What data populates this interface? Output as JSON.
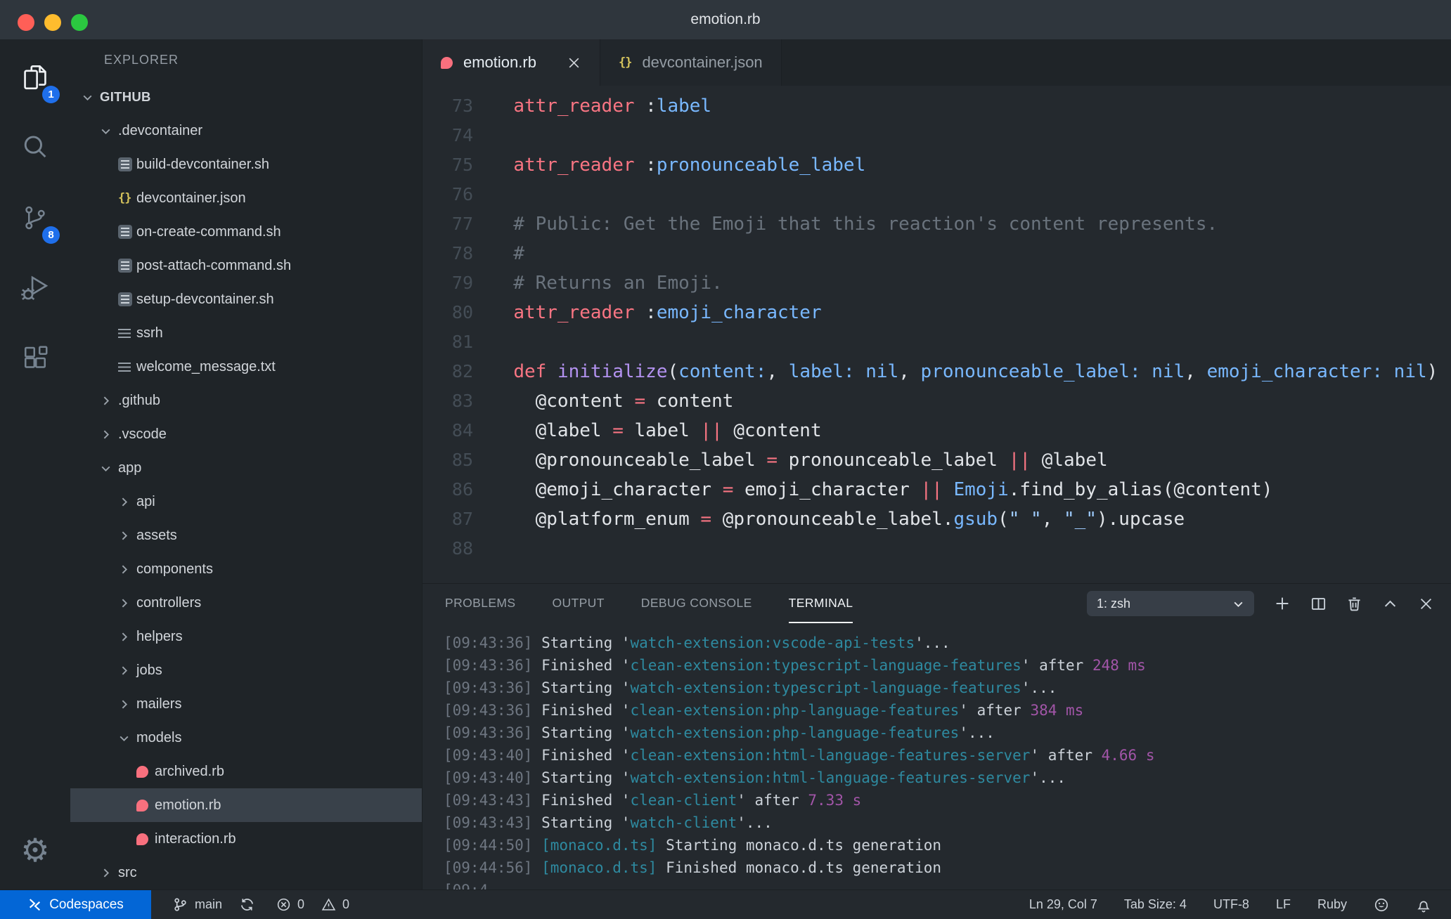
{
  "window": {
    "title": "emotion.rb"
  },
  "colors": {
    "accent": "#0366d6",
    "badge": "#1f6feb",
    "ruby": "#f8707e",
    "json_icon": "#d5c35c",
    "keyword": "#f97583",
    "symbol": "#79b8ff",
    "func": "#b392f0",
    "string": "#9ecbff",
    "comment": "#6a737d",
    "code_text": "#e1e4e8",
    "term_cyan": "#2e8aa0",
    "term_magenta": "#a255a8",
    "term_text": "#ccd2d9",
    "term_timestamp": "#6e7681"
  },
  "activity_bar": {
    "items": [
      {
        "name": "explorer",
        "active": true,
        "badge": "1"
      },
      {
        "name": "search"
      },
      {
        "name": "source-control",
        "badge": "8"
      },
      {
        "name": "run-debug"
      },
      {
        "name": "extensions"
      }
    ],
    "bottom_items": [
      {
        "name": "settings"
      }
    ]
  },
  "sidebar": {
    "header": "EXPLORER",
    "tree": [
      {
        "label": "GITHUB",
        "kind": "root",
        "expanded": true,
        "depth": 0
      },
      {
        "label": ".devcontainer",
        "kind": "folder",
        "expanded": true,
        "depth": 1
      },
      {
        "label": "build-devcontainer.sh",
        "kind": "file",
        "icon": "shell",
        "depth": 2
      },
      {
        "label": "devcontainer.json",
        "kind": "file",
        "icon": "json",
        "depth": 2
      },
      {
        "label": "on-create-command.sh",
        "kind": "file",
        "icon": "shell",
        "depth": 2
      },
      {
        "label": "post-attach-command.sh",
        "kind": "file",
        "icon": "shell",
        "depth": 2
      },
      {
        "label": "setup-devcontainer.sh",
        "kind": "file",
        "icon": "shell",
        "depth": 2
      },
      {
        "label": "ssrh",
        "kind": "file",
        "icon": "text",
        "depth": 2
      },
      {
        "label": "welcome_message.txt",
        "kind": "file",
        "icon": "text",
        "depth": 2
      },
      {
        "label": ".github",
        "kind": "folder",
        "expanded": false,
        "depth": 1
      },
      {
        "label": ".vscode",
        "kind": "folder",
        "expanded": false,
        "depth": 1
      },
      {
        "label": "app",
        "kind": "folder",
        "expanded": true,
        "depth": 1
      },
      {
        "label": "api",
        "kind": "folder",
        "expanded": false,
        "depth": 2
      },
      {
        "label": "assets",
        "kind": "folder",
        "expanded": false,
        "depth": 2
      },
      {
        "label": "components",
        "kind": "folder",
        "expanded": false,
        "depth": 2
      },
      {
        "label": "controllers",
        "kind": "folder",
        "expanded": false,
        "depth": 2
      },
      {
        "label": "helpers",
        "kind": "folder",
        "expanded": false,
        "depth": 2
      },
      {
        "label": "jobs",
        "kind": "folder",
        "expanded": false,
        "depth": 2
      },
      {
        "label": "mailers",
        "kind": "folder",
        "expanded": false,
        "depth": 2
      },
      {
        "label": "models",
        "kind": "folder",
        "expanded": true,
        "depth": 2
      },
      {
        "label": "archived.rb",
        "kind": "file",
        "icon": "ruby",
        "depth": 3
      },
      {
        "label": "emotion.rb",
        "kind": "file",
        "icon": "ruby",
        "depth": 3,
        "selected": true
      },
      {
        "label": "interaction.rb",
        "kind": "file",
        "icon": "ruby",
        "depth": 3
      },
      {
        "label": "src",
        "kind": "folder",
        "expanded": false,
        "depth": 1
      }
    ]
  },
  "editor": {
    "tabs": [
      {
        "label": "emotion.rb",
        "icon": "ruby",
        "active": true,
        "close": true
      },
      {
        "label": "devcontainer.json",
        "icon": "json",
        "active": false,
        "close": false
      }
    ],
    "code_lines": [
      {
        "num": "73",
        "tokens": [
          [
            "  ",
            "p"
          ],
          [
            "attr_reader",
            "k"
          ],
          [
            " :",
            "p"
          ],
          [
            "label",
            "b"
          ]
        ]
      },
      {
        "num": "74",
        "tokens": []
      },
      {
        "num": "75",
        "tokens": [
          [
            "  ",
            "p"
          ],
          [
            "attr_reader",
            "k"
          ],
          [
            " :",
            "p"
          ],
          [
            "pronounceable_label",
            "b"
          ]
        ]
      },
      {
        "num": "76",
        "tokens": []
      },
      {
        "num": "77",
        "tokens": [
          [
            "  # Public: Get the Emoji that this reaction's content represents.",
            "c"
          ]
        ]
      },
      {
        "num": "78",
        "tokens": [
          [
            "  #",
            "c"
          ]
        ]
      },
      {
        "num": "79",
        "tokens": [
          [
            "  # Returns an Emoji.",
            "c"
          ]
        ]
      },
      {
        "num": "80",
        "tokens": [
          [
            "  ",
            "p"
          ],
          [
            "attr_reader",
            "k"
          ],
          [
            " :",
            "p"
          ],
          [
            "emoji_character",
            "b"
          ]
        ]
      },
      {
        "num": "81",
        "tokens": []
      },
      {
        "num": "82",
        "tokens": [
          [
            "  ",
            "p"
          ],
          [
            "def",
            "k"
          ],
          [
            " ",
            "p"
          ],
          [
            "initialize",
            "f"
          ],
          [
            "(",
            "p"
          ],
          [
            "content:",
            "b"
          ],
          [
            ", ",
            "p"
          ],
          [
            "label:",
            "b"
          ],
          [
            " ",
            "p"
          ],
          [
            "nil",
            "b"
          ],
          [
            ", ",
            "p"
          ],
          [
            "pronounceable_label:",
            "b"
          ],
          [
            " ",
            "p"
          ],
          [
            "nil",
            "b"
          ],
          [
            ", ",
            "p"
          ],
          [
            "emoji_character:",
            "b"
          ],
          [
            " ",
            "p"
          ],
          [
            "nil",
            "b"
          ],
          [
            ")",
            "p"
          ]
        ]
      },
      {
        "num": "83",
        "tokens": [
          [
            "    @content ",
            "p"
          ],
          [
            "=",
            "k"
          ],
          [
            " content",
            "p"
          ]
        ]
      },
      {
        "num": "84",
        "tokens": [
          [
            "    @label ",
            "p"
          ],
          [
            "=",
            "k"
          ],
          [
            " label ",
            "p"
          ],
          [
            "||",
            "k"
          ],
          [
            " @content",
            "p"
          ]
        ]
      },
      {
        "num": "85",
        "tokens": [
          [
            "    @pronounceable_label ",
            "p"
          ],
          [
            "=",
            "k"
          ],
          [
            " pronounceable_label ",
            "p"
          ],
          [
            "||",
            "k"
          ],
          [
            " @label",
            "p"
          ]
        ]
      },
      {
        "num": "86",
        "tokens": [
          [
            "    @emoji_character ",
            "p"
          ],
          [
            "=",
            "k"
          ],
          [
            " emoji_character ",
            "p"
          ],
          [
            "||",
            "k"
          ],
          [
            " ",
            "p"
          ],
          [
            "Emoji",
            "b"
          ],
          [
            ".find_by_alias(@content)",
            "p"
          ]
        ]
      },
      {
        "num": "87",
        "tokens": [
          [
            "    @platform_enum ",
            "p"
          ],
          [
            "=",
            "k"
          ],
          [
            " @pronounceable_label.",
            "p"
          ],
          [
            "gsub",
            "b"
          ],
          [
            "(",
            "p"
          ],
          [
            "\" \"",
            "s"
          ],
          [
            ", ",
            "p"
          ],
          [
            "\"_\"",
            "s"
          ],
          [
            ")",
            "p"
          ],
          [
            ".upcase",
            "p"
          ]
        ]
      },
      {
        "num": "88",
        "tokens": []
      }
    ]
  },
  "panel": {
    "tabs": [
      {
        "label": "PROBLEMS"
      },
      {
        "label": "OUTPUT"
      },
      {
        "label": "DEBUG CONSOLE"
      },
      {
        "label": "TERMINAL",
        "active": true
      }
    ],
    "terminal_select": "1: zsh"
  },
  "terminal": {
    "lines": [
      [
        [
          "[09:43:36] ",
          "t"
        ],
        [
          "Starting '",
          "p"
        ],
        [
          "watch-extension:vscode-api-tests",
          "c"
        ],
        [
          "'...",
          "p"
        ]
      ],
      [
        [
          "[09:43:36] ",
          "t"
        ],
        [
          "Finished '",
          "p"
        ],
        [
          "clean-extension:typescript-language-features",
          "c"
        ],
        [
          "' after ",
          "p"
        ],
        [
          "248 ms",
          "m"
        ]
      ],
      [
        [
          "[09:43:36] ",
          "t"
        ],
        [
          "Starting '",
          "p"
        ],
        [
          "watch-extension:typescript-language-features",
          "c"
        ],
        [
          "'...",
          "p"
        ]
      ],
      [
        [
          "[09:43:36] ",
          "t"
        ],
        [
          "Finished '",
          "p"
        ],
        [
          "clean-extension:php-language-features",
          "c"
        ],
        [
          "' after ",
          "p"
        ],
        [
          "384 ms",
          "m"
        ]
      ],
      [
        [
          "[09:43:36] ",
          "t"
        ],
        [
          "Starting '",
          "p"
        ],
        [
          "watch-extension:php-language-features",
          "c"
        ],
        [
          "'...",
          "p"
        ]
      ],
      [
        [
          "[09:43:40] ",
          "t"
        ],
        [
          "Finished '",
          "p"
        ],
        [
          "clean-extension:html-language-features-server",
          "c"
        ],
        [
          "' after ",
          "p"
        ],
        [
          "4.66 s",
          "m"
        ]
      ],
      [
        [
          "[09:43:40] ",
          "t"
        ],
        [
          "Starting '",
          "p"
        ],
        [
          "watch-extension:html-language-features-server",
          "c"
        ],
        [
          "'...",
          "p"
        ]
      ],
      [
        [
          "[09:43:43] ",
          "t"
        ],
        [
          "Finished '",
          "p"
        ],
        [
          "clean-client",
          "c"
        ],
        [
          "' after ",
          "p"
        ],
        [
          "7.33 s",
          "m"
        ]
      ],
      [
        [
          "[09:43:43] ",
          "t"
        ],
        [
          "Starting '",
          "p"
        ],
        [
          "watch-client",
          "c"
        ],
        [
          "'...",
          "p"
        ]
      ],
      [
        [
          "[09:44:50] ",
          "t"
        ],
        [
          "[monaco.d.ts]",
          "c"
        ],
        [
          " Starting monaco.d.ts generation",
          "p"
        ]
      ],
      [
        [
          "[09:44:56] ",
          "t"
        ],
        [
          "[monaco.d.ts]",
          "c"
        ],
        [
          " Finished monaco.d.ts generation",
          "p"
        ]
      ],
      [
        [
          "[09:4",
          "t"
        ]
      ]
    ]
  },
  "status_bar": {
    "codespaces": "Codespaces",
    "branch": "main",
    "errors": "0",
    "warnings": "0",
    "right": [
      {
        "name": "cursor-position",
        "label": "Ln 29, Col 7"
      },
      {
        "name": "tab-size",
        "label": "Tab Size: 4"
      },
      {
        "name": "encoding",
        "label": "UTF-8"
      },
      {
        "name": "eol",
        "label": "LF"
      },
      {
        "name": "language-mode",
        "label": "Ruby"
      }
    ]
  }
}
